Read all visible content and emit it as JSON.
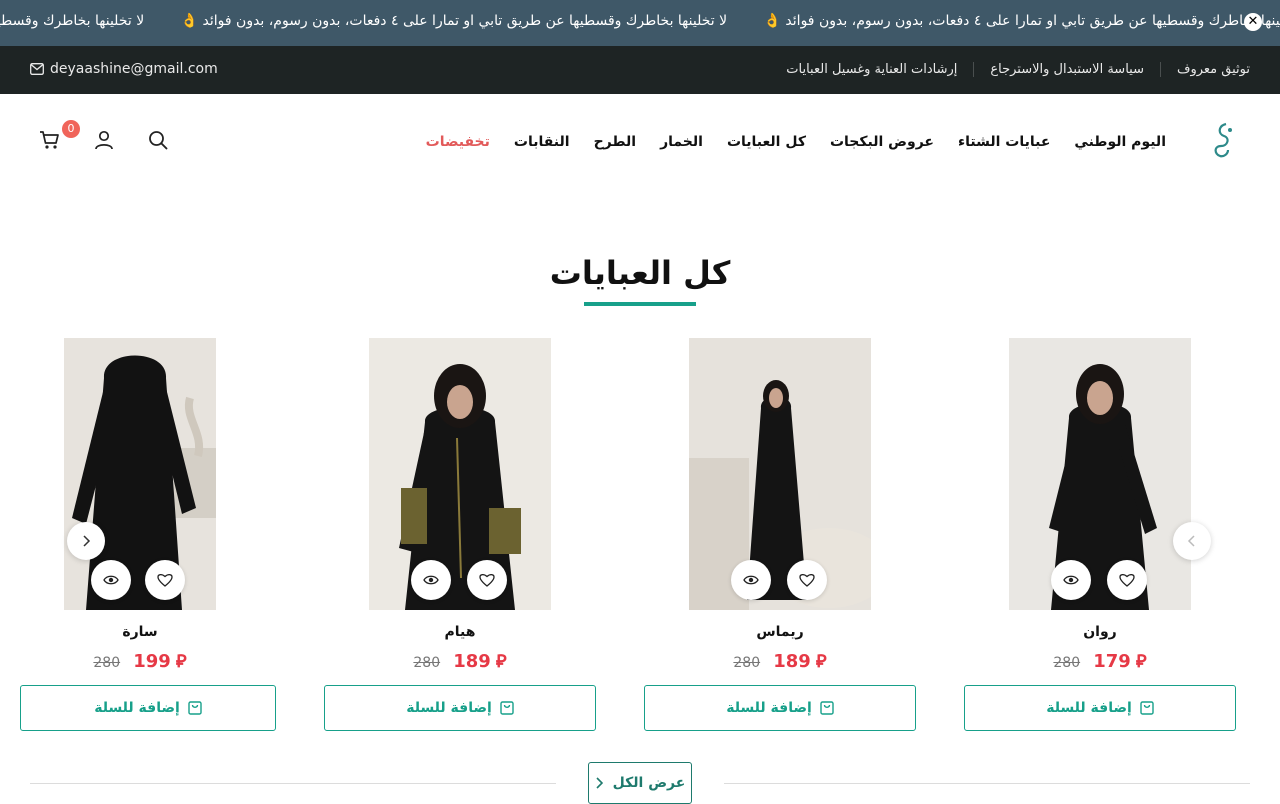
{
  "announcement": {
    "items": [
      "لا تخلينها بخاطرك وقسطيها عن طريق تابي او تمارا على ٤ دفعات، بدون رسوم، بدون فوائد 👌",
      "لا تخلينها بخاطرك وقسطيها عن طريق تابي او تمارا على ٤ دفعات، بدون رسوم، بدون فوائد 👌",
      "لا تخلينها بخاطرك وقسطيها عن طريق تابي او تمارا على ٤ دفعات، بدون رسوم، بدون فوائد 👌"
    ],
    "close_label": "✕"
  },
  "topbar": {
    "email": "deyaashine@gmail.com",
    "links": [
      "توثيق معروف",
      "سياسة الاستبدال والاسترجاع",
      "إرشادات العناية وغسيل العبايات"
    ]
  },
  "nav": {
    "items": [
      "اليوم الوطني",
      "عبايات الشتاء",
      "عروض البكجات",
      "كل العبايات",
      "الخمار",
      "الطرح",
      "النقابات",
      "تخفيضات"
    ]
  },
  "cart": {
    "count": "0"
  },
  "section": {
    "title": "كل العبايات"
  },
  "products": [
    {
      "name": "روان",
      "price": "179",
      "old_price": "280",
      "add_label": "إضافة للسلة"
    },
    {
      "name": "ريماس",
      "price": "189",
      "old_price": "280",
      "add_label": "إضافة للسلة"
    },
    {
      "name": "هيام",
      "price": "189",
      "old_price": "280",
      "add_label": "إضافة للسلة"
    },
    {
      "name": "سارة",
      "price": "199",
      "old_price": "280",
      "add_label": "إضافة للسلة"
    }
  ],
  "currency_symbol": "⃁",
  "view_all": {
    "label": "عرض الكل"
  },
  "colors": {
    "accent": "#17a08a",
    "sale": "#e25a5a",
    "price": "#e63946",
    "announce_bg": "#3f5868",
    "topbar_bg": "#1e2424"
  }
}
